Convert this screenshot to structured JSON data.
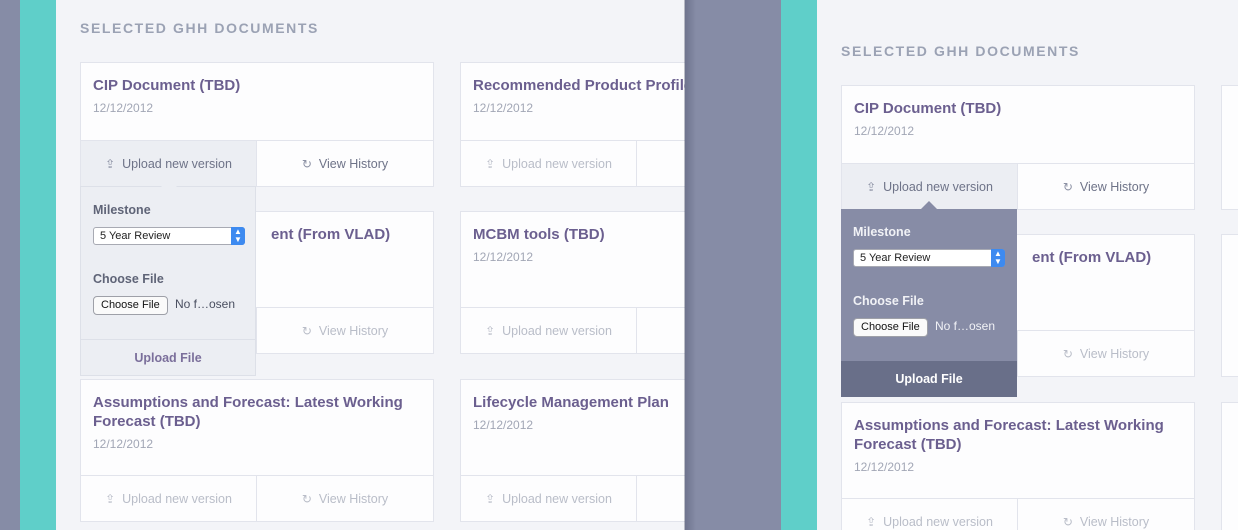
{
  "section_title": "SELECTED GHH DOCUMENTS",
  "actions": {
    "upload": "Upload new version",
    "history": "View History"
  },
  "popover": {
    "milestone_label": "Milestone",
    "milestone_value": "5 Year Review",
    "choose_file_label": "Choose File",
    "choose_file_button": "Choose File",
    "file_status": "No f…osen",
    "submit": "Upload File"
  },
  "documents": [
    {
      "title": "CIP Document (TBD)",
      "date": "12/12/2012"
    },
    {
      "title": "Recommended Product Profile",
      "date": "12/12/2012"
    },
    {
      "title_partial": "ent (From VLAD)"
    },
    {
      "title": "MCBM tools (TBD)",
      "date": "12/12/2012"
    },
    {
      "title": "Assumptions and Forecast: Latest Working Forecast (TBD)",
      "date": "12/12/2012"
    },
    {
      "title": "Lifecycle Management Plan",
      "date": "12/12/2012"
    }
  ]
}
